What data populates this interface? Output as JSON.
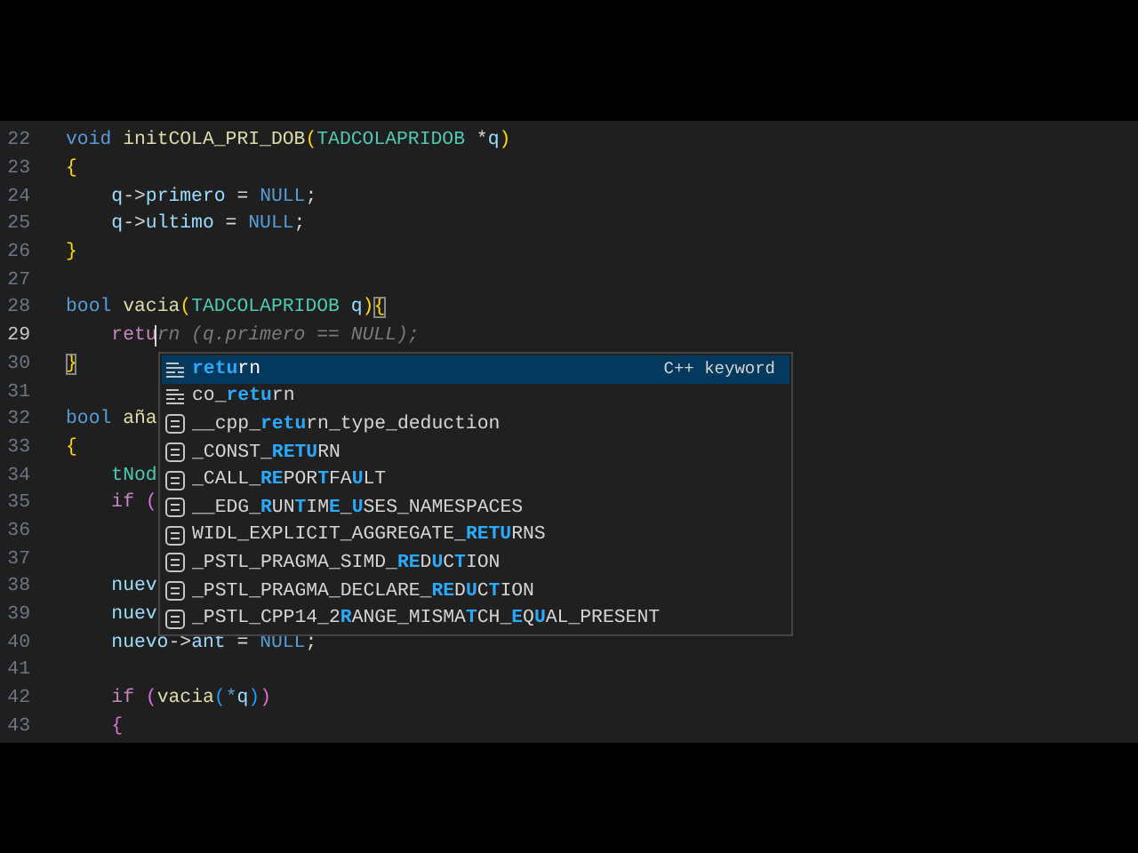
{
  "editor": {
    "lines": [
      {
        "number": "22",
        "current": false,
        "tokens": [
          {
            "text": "void ",
            "kind": "keyword"
          },
          {
            "text": "initCOLA_PRI_DOB",
            "kind": "function"
          },
          {
            "text": "(",
            "kind": "bracket1"
          },
          {
            "text": "TADCOLAPRIDOB",
            "kind": "type"
          },
          {
            "text": " *",
            "kind": "plain"
          },
          {
            "text": "q",
            "kind": "variable"
          },
          {
            "text": ")",
            "kind": "bracket1"
          }
        ]
      },
      {
        "number": "23",
        "current": false,
        "tokens": [
          {
            "text": "{",
            "kind": "bracket1"
          }
        ]
      },
      {
        "number": "24",
        "current": false,
        "tokens": [
          {
            "text": "    q",
            "kind": "variable"
          },
          {
            "text": "->",
            "kind": "plain"
          },
          {
            "text": "primero",
            "kind": "variable"
          },
          {
            "text": " = ",
            "kind": "plain"
          },
          {
            "text": "NULL",
            "kind": "keyword"
          },
          {
            "text": ";",
            "kind": "plain"
          }
        ]
      },
      {
        "number": "25",
        "current": false,
        "tokens": [
          {
            "text": "    q",
            "kind": "variable"
          },
          {
            "text": "->",
            "kind": "plain"
          },
          {
            "text": "ultimo",
            "kind": "variable"
          },
          {
            "text": " = ",
            "kind": "plain"
          },
          {
            "text": "NULL",
            "kind": "keyword"
          },
          {
            "text": ";",
            "kind": "plain"
          }
        ]
      },
      {
        "number": "26",
        "current": false,
        "tokens": [
          {
            "text": "}",
            "kind": "bracket1"
          }
        ]
      },
      {
        "number": "27",
        "current": false
      },
      {
        "number": "28",
        "current": false,
        "tokens": [
          {
            "text": "bool ",
            "kind": "keyword"
          },
          {
            "text": "vacia",
            "kind": "function"
          },
          {
            "text": "(",
            "kind": "bracket1"
          },
          {
            "text": "TADCOLAPRIDOB",
            "kind": "type"
          },
          {
            "text": " q",
            "kind": "variable"
          },
          {
            "text": ")",
            "kind": "bracket1"
          },
          {
            "text": "{",
            "kind": "matched_brace"
          }
        ]
      },
      {
        "number": "29",
        "current": true,
        "tokens": [
          {
            "text": "    retu",
            "kind": "control",
            "cursor": true
          },
          {
            "text": "rn (q.primero == NULL);",
            "kind": "ghost"
          }
        ]
      },
      {
        "number": "30",
        "current": false,
        "tokens": [
          {
            "text": "}",
            "kind": "matched_brace"
          }
        ]
      },
      {
        "number": "31",
        "current": false
      },
      {
        "number": "32",
        "current": false,
        "tokens": [
          {
            "text": "bool ",
            "kind": "keyword"
          },
          {
            "text": "aña",
            "kind": "function"
          }
        ]
      },
      {
        "number": "33",
        "current": false,
        "tokens": [
          {
            "text": "{",
            "kind": "bracket1"
          }
        ]
      },
      {
        "number": "34",
        "current": false,
        "tokens": [
          {
            "text": "    tNod",
            "kind": "type"
          }
        ]
      },
      {
        "number": "35",
        "current": false,
        "tokens": [
          {
            "text": "    if ",
            "kind": "control"
          },
          {
            "text": "(",
            "kind": "bracket2"
          }
        ]
      },
      {
        "number": "36",
        "current": false
      },
      {
        "number": "37",
        "current": false
      },
      {
        "number": "38",
        "current": false,
        "tokens": [
          {
            "text": "    nuev",
            "kind": "variable"
          }
        ]
      },
      {
        "number": "39",
        "current": false,
        "tokens": [
          {
            "text": "    nuev",
            "kind": "variable"
          }
        ]
      },
      {
        "number": "40",
        "current": false,
        "tokens": [
          {
            "text": "    nuevo",
            "kind": "variable"
          },
          {
            "text": "->",
            "kind": "plain"
          },
          {
            "text": "ant",
            "kind": "variable"
          },
          {
            "text": " = ",
            "kind": "plain"
          },
          {
            "text": "NULL",
            "kind": "keyword"
          },
          {
            "text": ";",
            "kind": "plain"
          }
        ]
      },
      {
        "number": "41",
        "current": false
      },
      {
        "number": "42",
        "current": false,
        "tokens": [
          {
            "text": "    if ",
            "kind": "control"
          },
          {
            "text": "(",
            "kind": "bracket2"
          },
          {
            "text": "vacia",
            "kind": "function"
          },
          {
            "text": "(",
            "kind": "bracket3"
          },
          {
            "text": "*",
            "kind": "keyword"
          },
          {
            "text": "q",
            "kind": "variable"
          },
          {
            "text": ")",
            "kind": "bracket3"
          },
          {
            "text": ")",
            "kind": "bracket2"
          }
        ]
      },
      {
        "number": "43",
        "current": false,
        "tokens": [
          {
            "text": "    {",
            "kind": "bracket2"
          }
        ]
      }
    ]
  },
  "suggest": {
    "items": [
      {
        "kind": "keyword",
        "selected": true,
        "detail": "C++ keyword",
        "parts": [
          {
            "text": "retu",
            "match": true
          },
          {
            "text": "rn",
            "match": false
          }
        ]
      },
      {
        "kind": "keyword",
        "selected": false,
        "parts": [
          {
            "text": "co_",
            "match": false
          },
          {
            "text": "retu",
            "match": true
          },
          {
            "text": "rn",
            "match": false
          }
        ]
      },
      {
        "kind": "constant",
        "selected": false,
        "parts": [
          {
            "text": "__cpp_",
            "match": false
          },
          {
            "text": "retu",
            "match": true
          },
          {
            "text": "rn_type_deduction",
            "match": false
          }
        ]
      },
      {
        "kind": "constant",
        "selected": false,
        "parts": [
          {
            "text": "_CONST_",
            "match": false
          },
          {
            "text": "RETU",
            "match": true
          },
          {
            "text": "RN",
            "match": false
          }
        ]
      },
      {
        "kind": "constant",
        "selected": false,
        "parts": [
          {
            "text": "_CALL_",
            "match": false
          },
          {
            "text": "RE",
            "match": true
          },
          {
            "text": "POR",
            "match": false
          },
          {
            "text": "T",
            "match": true
          },
          {
            "text": "FA",
            "match": false
          },
          {
            "text": "U",
            "match": true
          },
          {
            "text": "LT",
            "match": false
          }
        ]
      },
      {
        "kind": "constant",
        "selected": false,
        "parts": [
          {
            "text": "__EDG_",
            "match": false
          },
          {
            "text": "R",
            "match": true
          },
          {
            "text": "UN",
            "match": false
          },
          {
            "text": "T",
            "match": true
          },
          {
            "text": "IM",
            "match": false
          },
          {
            "text": "E",
            "match": true
          },
          {
            "text": "_",
            "match": false
          },
          {
            "text": "U",
            "match": true
          },
          {
            "text": "SES_NAMESPACES",
            "match": false
          }
        ]
      },
      {
        "kind": "constant",
        "selected": false,
        "parts": [
          {
            "text": "WIDL_EXPLICIT_AGGREGATE_",
            "match": false
          },
          {
            "text": "RETU",
            "match": true
          },
          {
            "text": "RNS",
            "match": false
          }
        ]
      },
      {
        "kind": "constant",
        "selected": false,
        "parts": [
          {
            "text": "_PSTL_PRAGMA_SIMD_",
            "match": false
          },
          {
            "text": "RE",
            "match": true
          },
          {
            "text": "D",
            "match": false
          },
          {
            "text": "U",
            "match": true
          },
          {
            "text": "C",
            "match": false
          },
          {
            "text": "T",
            "match": true
          },
          {
            "text": "ION",
            "match": false
          }
        ]
      },
      {
        "kind": "constant",
        "selected": false,
        "parts": [
          {
            "text": "_PSTL_PRAGMA_DECLARE_",
            "match": false
          },
          {
            "text": "RE",
            "match": true
          },
          {
            "text": "D",
            "match": false
          },
          {
            "text": "U",
            "match": true
          },
          {
            "text": "C",
            "match": false
          },
          {
            "text": "T",
            "match": true
          },
          {
            "text": "ION",
            "match": false
          }
        ]
      },
      {
        "kind": "constant",
        "selected": false,
        "parts": [
          {
            "text": "_PSTL_CPP14_2",
            "match": false
          },
          {
            "text": "R",
            "match": true
          },
          {
            "text": "ANGE_MISMA",
            "match": false
          },
          {
            "text": "T",
            "match": true
          },
          {
            "text": "CH_",
            "match": false
          },
          {
            "text": "E",
            "match": true
          },
          {
            "text": "Q",
            "match": false
          },
          {
            "text": "U",
            "match": true
          },
          {
            "text": "AL_PRESENT",
            "match": false
          }
        ]
      }
    ]
  }
}
